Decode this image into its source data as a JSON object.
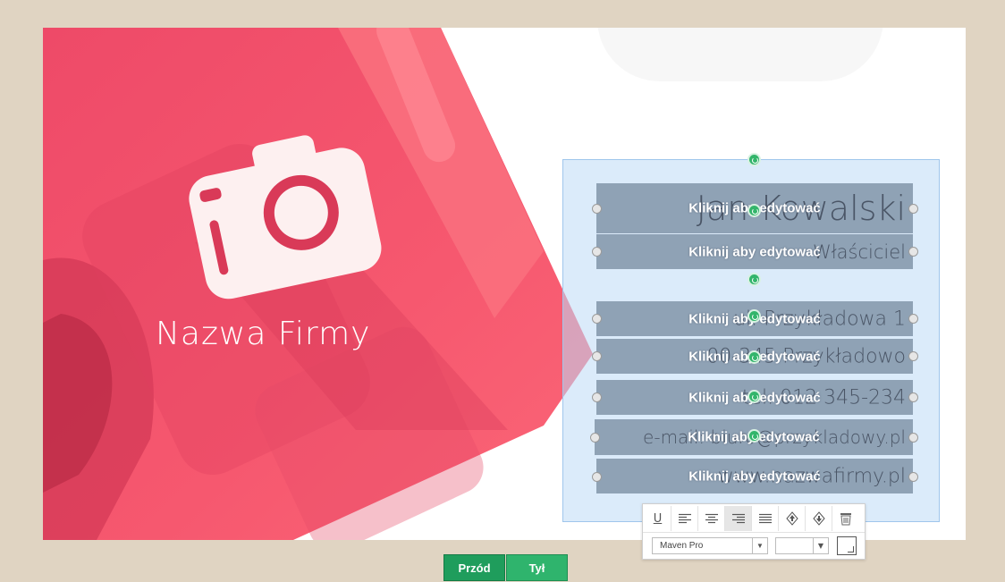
{
  "card": {
    "company_name": "Nazwa Firmy",
    "colors": {
      "accent": "#f2566e",
      "accent_dark": "#d63a58",
      "background": "#ffffff"
    }
  },
  "fields": [
    {
      "value": "Jan Kowalski",
      "hint": "Kliknij aby edytować"
    },
    {
      "value": "Właściciel",
      "hint": "Kliknij aby edytować"
    },
    {
      "value": "ul. Przykładowa 1",
      "hint": "Kliknij aby edytować"
    },
    {
      "value": "00-345 Przykładowo",
      "hint": "Kliknij aby edytować"
    },
    {
      "value": "tel. 012 345-234",
      "hint": "Kliknij aby edytować"
    },
    {
      "value": "e-mail: biuro@przykladowy.pl",
      "hint": "Kliknij aby edytować"
    },
    {
      "value": "www.nazwafirmy.pl",
      "hint": "Kliknij aby edytować"
    }
  ],
  "toolbar": {
    "buttons": [
      "underline-icon",
      "align-left-icon",
      "align-center-icon",
      "align-right-icon",
      "align-justify-icon",
      "bring-forward-icon",
      "send-backward-icon",
      "trash-icon"
    ],
    "active_button": "align-right-icon",
    "font_family": "Maven Pro",
    "font_size": ""
  },
  "sides": {
    "front": "Przód",
    "back": "Tył"
  }
}
